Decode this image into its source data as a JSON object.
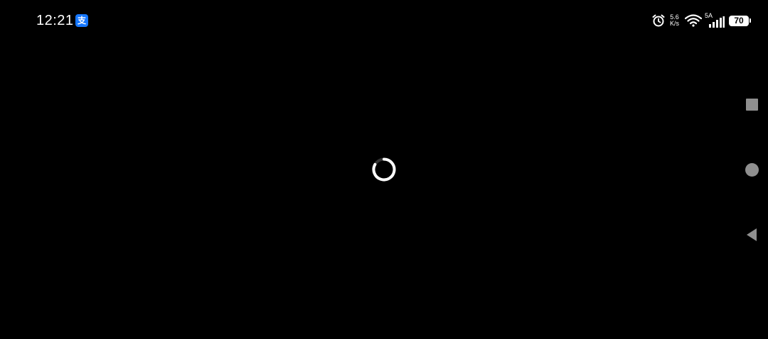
{
  "status_bar": {
    "time": "12:21",
    "app_badge": "支",
    "network_speed_value": "5.6",
    "network_speed_unit": "K/s",
    "network_type": "5A",
    "battery_level": "70"
  },
  "colors": {
    "background": "#000000",
    "app_badge": "#1677ff",
    "nav_buttons": "#8f8f8f"
  },
  "content": {
    "state": "loading"
  },
  "navigation": {
    "buttons": [
      "recent-apps",
      "home",
      "back"
    ]
  }
}
